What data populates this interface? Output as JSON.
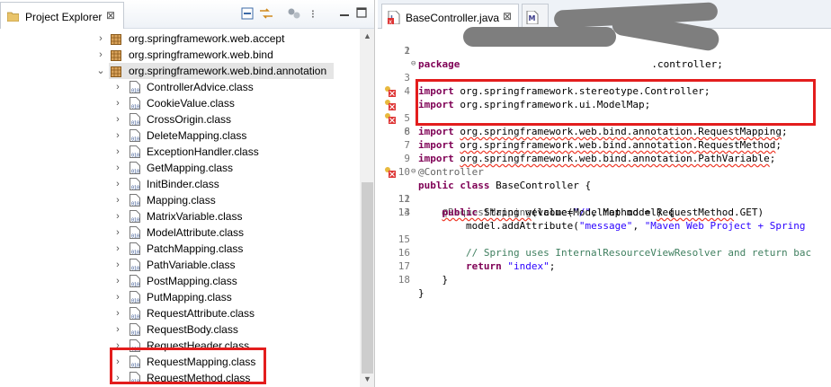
{
  "project_explorer": {
    "title": "Project Explorer",
    "close_glyph": "⊠",
    "packages": [
      {
        "label": "org.springframework.web.accept",
        "expanded": false
      },
      {
        "label": "org.springframework.web.bind",
        "expanded": false
      },
      {
        "label": "org.springframework.web.bind.annotation",
        "expanded": true
      }
    ],
    "classes": [
      "ControllerAdvice.class",
      "CookieValue.class",
      "CrossOrigin.class",
      "DeleteMapping.class",
      "ExceptionHandler.class",
      "GetMapping.class",
      "InitBinder.class",
      "Mapping.class",
      "MatrixVariable.class",
      "ModelAttribute.class",
      "PatchMapping.class",
      "PathVariable.class",
      "PostMapping.class",
      "PutMapping.class",
      "RequestAttribute.class",
      "RequestBody.class",
      "RequestHeader.class",
      "RequestMapping.class",
      "RequestMethod.class"
    ]
  },
  "editor": {
    "active_tab": "BaseController.java",
    "close_glyph": "⊠",
    "code": {
      "l1_kw": "package",
      "l1_rest": ".controller;",
      "l3_kw": "import",
      "l3_rest": " org.springframework.stereotype.Controller;",
      "l4_kw": "import",
      "l4_rest": " org.springframework.ui.ModelMap;",
      "l5_kw": "import",
      "l5_rest": "org.springframework.web.bind.annotation.RequestMapping",
      "l6_kw": "import",
      "l6_rest": "org.springframework.web.bind.annotation.RequestMethod",
      "l7_kw": "import",
      "l7_rest": "org.springframework.web.bind.annotation.PathVariable",
      "semi": ";",
      "l9": "@Controller",
      "l10_kw1": "public",
      "l10_kw2": "class",
      "l10_rest": " BaseController {",
      "l11_a": "@RequestMapping",
      "l11_b": "(value=",
      "l11_c": "\"/\"",
      "l11_d": ", method = ",
      "l11_e": "RequestMethod",
      "l11_f": ".GET)",
      "l12_kw": "public",
      "l12_rest": " String welcome(ModelMap model) {",
      "l13_a": "model.addAttribute(",
      "l13_b": "\"message\"",
      "l13_c": ", ",
      "l13_d": "\"Maven Web Project + Spring",
      "l15": "// Spring uses InternalResourceViewResolver and return bac",
      "l16_kw": "return",
      "l16_st": "\"index\"",
      "l16_end": ";",
      "l17": "}",
      "l18": "}"
    }
  },
  "colors": {
    "highlight_box": "#e31d1d",
    "keyword": "#7f0055",
    "string": "#2a00ff",
    "comment": "#3f7f5f"
  }
}
